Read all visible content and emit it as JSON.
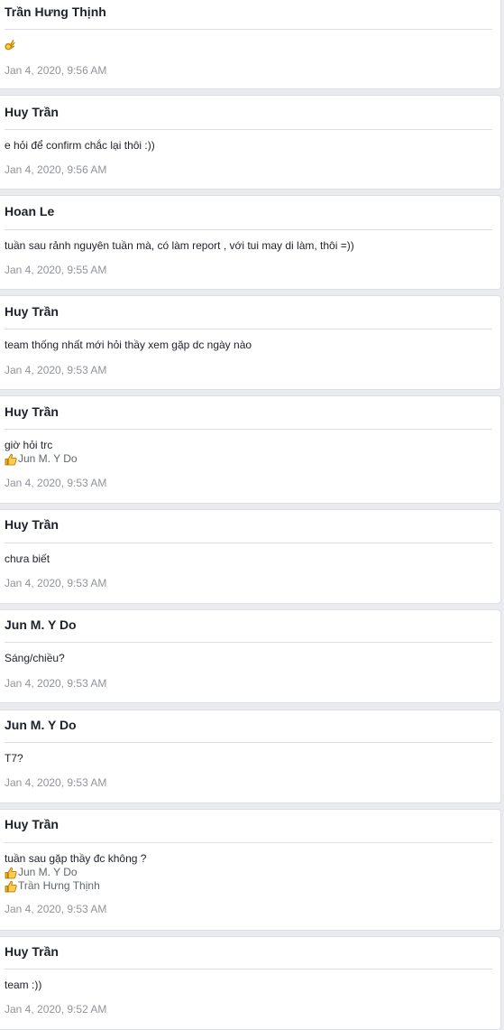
{
  "posts": [
    {
      "author": "Trần Hưng Thịnh",
      "text": "",
      "emoji": "ok-hand-icon",
      "reactions": [],
      "time": "Jan 4, 2020, 9:56 AM"
    },
    {
      "author": "Huy Trần",
      "text": "e hỏi để confirm chắc lại thôi :))",
      "reactions": [],
      "time": "Jan 4, 2020, 9:56 AM"
    },
    {
      "author": "Hoan Le",
      "text": "tuần sau rảnh nguyên tuần mà, có làm report , với tui may di làm, thôi =))",
      "reactions": [],
      "time": "Jan 4, 2020, 9:55 AM"
    },
    {
      "author": "Huy Trần",
      "text": "team thống nhất mới hỏi thầy xem gặp dc ngày nào",
      "reactions": [],
      "time": "Jan 4, 2020, 9:53 AM"
    },
    {
      "author": "Huy Trần",
      "text": "giờ hỏi trc",
      "reactions": [
        {
          "icon": "thumbs-up-icon",
          "name": "Jun M. Y Do"
        }
      ],
      "time": "Jan 4, 2020, 9:53 AM"
    },
    {
      "author": "Huy Trần",
      "text": "chưa biết",
      "reactions": [],
      "time": "Jan 4, 2020, 9:53 AM"
    },
    {
      "author": "Jun M. Y Do",
      "text": "Sáng/chiều?",
      "reactions": [],
      "time": "Jan 4, 2020, 9:53 AM"
    },
    {
      "author": "Jun M. Y Do",
      "text": "T7?",
      "reactions": [],
      "time": "Jan 4, 2020, 9:53 AM"
    },
    {
      "author": "Huy Trần",
      "text": "tuần sau gặp thầy đc không ?",
      "reactions": [
        {
          "icon": "thumbs-up-icon",
          "name": "Jun M. Y Do"
        },
        {
          "icon": "thumbs-up-icon",
          "name": "Trần Hưng Thịnh"
        }
      ],
      "time": "Jan 4, 2020, 9:53 AM"
    },
    {
      "author": "Huy Trần",
      "text": "team :))",
      "reactions": [],
      "time": "Jan 4, 2020, 9:52 AM"
    }
  ]
}
